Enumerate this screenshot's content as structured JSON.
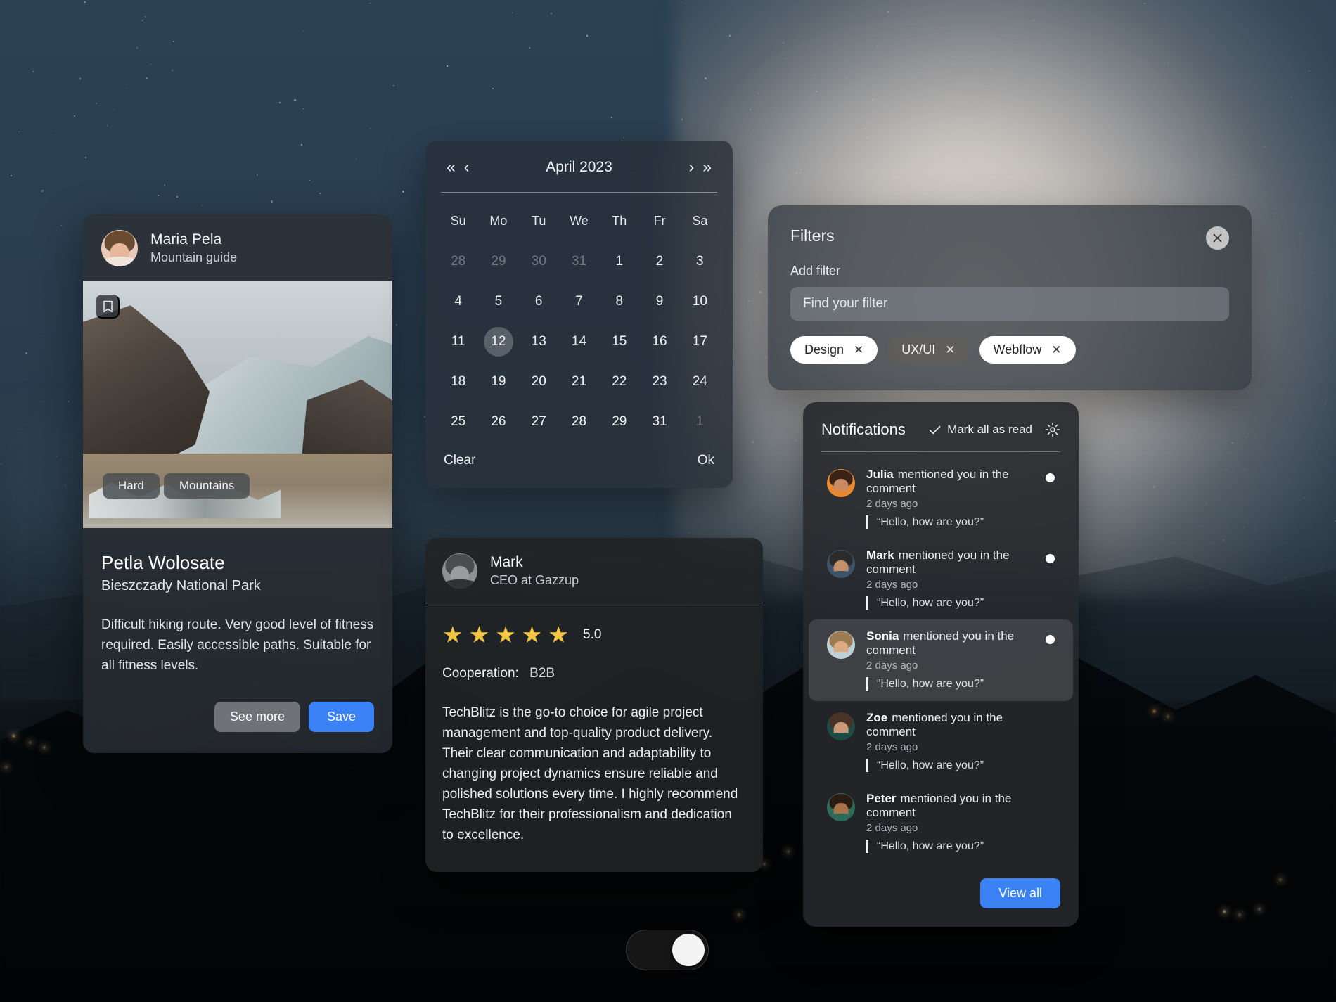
{
  "trip_card": {
    "author_name": "Maria Pela",
    "author_role": "Mountain guide",
    "bookmark_icon": "bookmark-icon",
    "tags": [
      "Hard",
      "Mountains"
    ],
    "title": "Petla Wolosate",
    "subtitle": "Bieszczady National Park",
    "description": "Difficult hiking route. Very good level of fitness required. Easily accessible paths. Suitable for all fitness levels.",
    "see_more_label": "See more",
    "save_label": "Save",
    "save_color": "#3b82f6"
  },
  "calendar": {
    "title": "April 2023",
    "nav": {
      "first": "«",
      "prev": "‹",
      "next": "›",
      "last": "»"
    },
    "weekdays": [
      "Su",
      "Mo",
      "Tu",
      "We",
      "Th",
      "Fr",
      "Sa"
    ],
    "weeks": [
      [
        {
          "d": "28",
          "muted": true
        },
        {
          "d": "29",
          "muted": true
        },
        {
          "d": "30",
          "muted": true
        },
        {
          "d": "31",
          "muted": true
        },
        {
          "d": "1"
        },
        {
          "d": "2"
        },
        {
          "d": "3"
        }
      ],
      [
        {
          "d": "4"
        },
        {
          "d": "5"
        },
        {
          "d": "6"
        },
        {
          "d": "7"
        },
        {
          "d": "8"
        },
        {
          "d": "9"
        },
        {
          "d": "10"
        }
      ],
      [
        {
          "d": "11"
        },
        {
          "d": "12",
          "selected": true
        },
        {
          "d": "13"
        },
        {
          "d": "14"
        },
        {
          "d": "15"
        },
        {
          "d": "16"
        },
        {
          "d": "17"
        }
      ],
      [
        {
          "d": "18"
        },
        {
          "d": "19"
        },
        {
          "d": "20"
        },
        {
          "d": "21"
        },
        {
          "d": "22"
        },
        {
          "d": "23"
        },
        {
          "d": "24"
        }
      ],
      [
        {
          "d": "25"
        },
        {
          "d": "26"
        },
        {
          "d": "27"
        },
        {
          "d": "28"
        },
        {
          "d": "29"
        },
        {
          "d": "31"
        },
        {
          "d": "1",
          "muted": true
        }
      ]
    ],
    "clear_label": "Clear",
    "ok_label": "Ok"
  },
  "filters": {
    "title": "Filters",
    "close_icon": "close-icon",
    "add_filter_label": "Add filter",
    "search_placeholder": "Find your filter",
    "search_value": "",
    "chips": [
      {
        "label": "Design",
        "style": "light"
      },
      {
        "label": "UX/UI",
        "style": "dark"
      },
      {
        "label": "Webflow",
        "style": "light"
      }
    ]
  },
  "review": {
    "name": "Mark",
    "role": "CEO at Gazzup",
    "stars": 5,
    "rating": "5.0",
    "star_color": "#f4c542",
    "cooperation_label": "Cooperation:",
    "cooperation_value": "B2B",
    "text": "TechBlitz is the go-to choice for agile project management and top-quality product delivery. Their clear communication and adaptability to changing project dynamics ensure reliable and polished solutions every time. I highly recommend TechBlitz for their professionalism and dedication to excellence."
  },
  "notifications": {
    "title": "Notifications",
    "mark_all_label": "Mark all as read",
    "check_icon": "check-icon",
    "gear_icon": "gear-icon",
    "view_all_label": "View all",
    "view_all_color": "#3b82f6",
    "items": [
      {
        "name": "Julia",
        "action": "mentioned you in the comment",
        "time": "2 days ago",
        "quote": "“Hello, how are you?”",
        "unread": true,
        "active": false,
        "hair": "#3a2418",
        "skin": "#c98b63",
        "body": "#e8892f"
      },
      {
        "name": "Mark",
        "action": "mentioned you in the comment",
        "time": "2 days ago",
        "quote": "“Hello, how are you?”",
        "unread": true,
        "active": false,
        "hair": "#2b2b2b",
        "skin": "#c3906c",
        "body": "#3d5468"
      },
      {
        "name": "Sonia",
        "action": "mentioned you in the comment",
        "time": "2 days ago",
        "quote": "“Hello, how are you?”",
        "unread": true,
        "active": true,
        "hair": "#9c7a52",
        "skin": "#dcab85",
        "body": "#bcd1d6"
      },
      {
        "name": "Zoe",
        "action": "mentioned you in the comment",
        "time": "2 days ago",
        "quote": "“Hello, how are you?”",
        "unread": false,
        "active": false,
        "hair": "#4a3326",
        "skin": "#cb9a78",
        "body": "#1d4a44"
      },
      {
        "name": "Peter",
        "action": "mentioned you in the comment",
        "time": "2 days ago",
        "quote": "“Hello, how are you?”",
        "unread": false,
        "active": false,
        "hair": "#2a1c12",
        "skin": "#a8724a",
        "body": "#2e6a5a"
      }
    ]
  },
  "theme_toggle": {
    "state": "on",
    "name": "theme-toggle"
  }
}
